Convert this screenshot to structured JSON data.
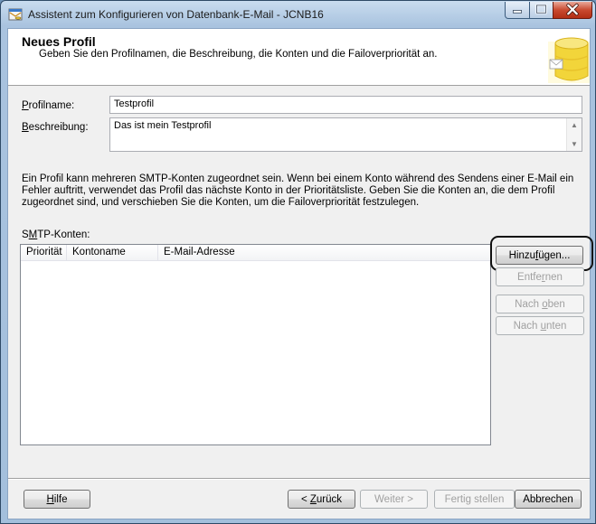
{
  "window": {
    "title": "Assistent zum Konfigurieren von Datenbank-E-Mail - JCNB16"
  },
  "header": {
    "title": "Neues Profil",
    "subtitle": "Geben Sie den Profilnamen, die Beschreibung, die Konten und die Failoverpriorität an."
  },
  "form": {
    "profile_label_accel": "P",
    "profile_label_rest": "rofilname:",
    "profile_value": "Testprofil",
    "description_label_accel": "B",
    "description_label_rest": "eschreibung:",
    "description_value": "Das ist mein Testprofil"
  },
  "info_text": "Ein Profil kann mehreren SMTP-Konten zugeordnet sein. Wenn bei einem Konto während des Sendens einer E-Mail ein Fehler auftritt, verwendet das Profil das nächste Konto in der Prioritätsliste. Geben Sie die Konten an, die dem Profil zugeordnet sind, und verschieben Sie die Konten, um die Failoverpriorität festzulegen.",
  "smtp": {
    "label_pre": "S",
    "label_accel": "M",
    "label_post": "TP-Konten:",
    "columns": [
      "Priorität",
      "Kontoname",
      "E-Mail-Adresse"
    ]
  },
  "side_buttons": {
    "add_pre": "Hinzu",
    "add_accel": "f",
    "add_post": "ügen...",
    "remove_pre": "Entfe",
    "remove_accel": "r",
    "remove_post": "nen",
    "up_pre": "Nach ",
    "up_accel": "o",
    "up_post": "ben",
    "down_pre": "Nach ",
    "down_accel": "u",
    "down_post": "nten"
  },
  "footer": {
    "help_pre": "",
    "help_accel": "H",
    "help_post": "ilfe",
    "back_pre": "< ",
    "back_accel": "Z",
    "back_post": "urück",
    "next": "Weiter >",
    "finish": "Fertig stellen",
    "cancel": "Abbrechen"
  },
  "colors": {
    "title_bar": "#a9c3df",
    "client_bg": "#f0f0f0",
    "close_button": "#c94a30",
    "highlight_ring": "#111111"
  },
  "icons": {
    "app": "database-mail-icon",
    "header_logo": "database-icon"
  }
}
